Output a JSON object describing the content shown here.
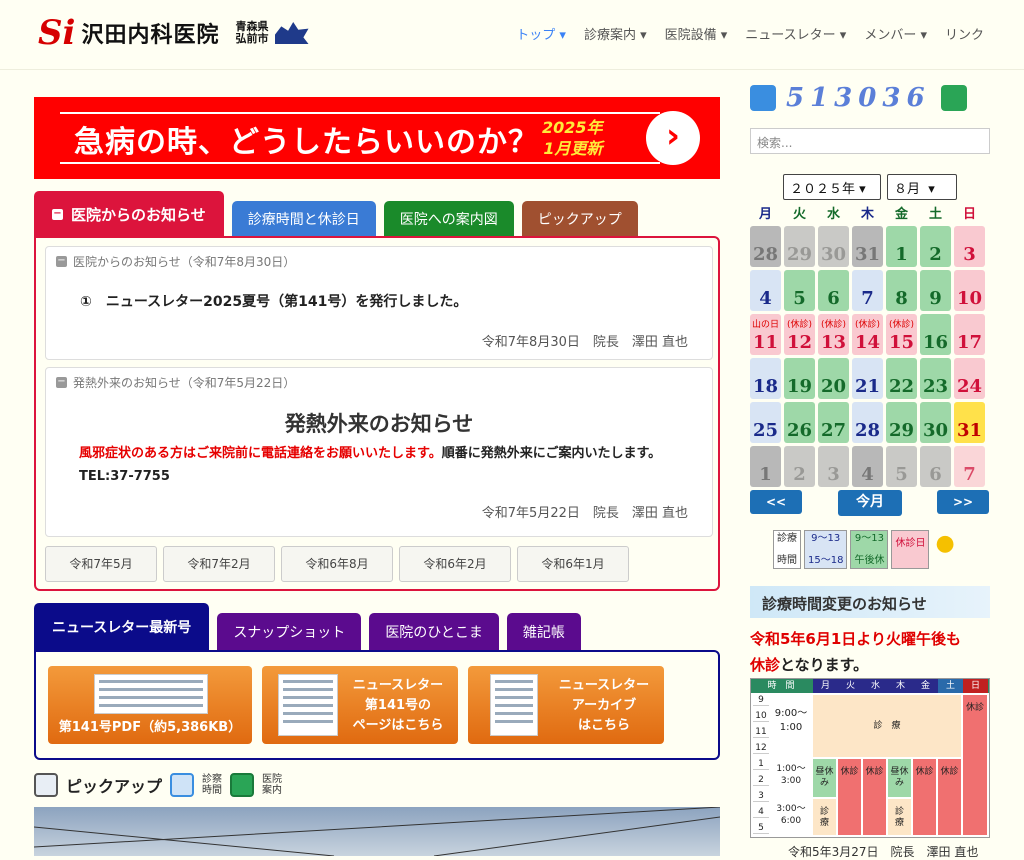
{
  "header": {
    "logo_mark": "Si",
    "logo_name": "沢田内科医院",
    "logo_pref": "青森県",
    "logo_city": "弘前市"
  },
  "nav": {
    "items": [
      {
        "label": "トップ ▾"
      },
      {
        "label": "診療案内 ▾"
      },
      {
        "label": "医院設備 ▾"
      },
      {
        "label": "ニュースレター ▾"
      },
      {
        "label": "メンバー ▾"
      },
      {
        "label": "リンク"
      }
    ]
  },
  "banner": {
    "text": "急病の時、どうしたらいいのか？",
    "sub1": "2025年",
    "sub2": "1月更新",
    "arrow": "›"
  },
  "tabs1": {
    "t0": "医院からのお知らせ",
    "t1": "診療時間と休診日",
    "t2": "医院への案内図",
    "t3": "ピックアップ"
  },
  "notice1": {
    "header": "医院からのお知らせ（令和7年8月30日）",
    "text": "①　ニュースレター2025夏号（第141号）を発行しました。",
    "sig": "令和7年8月30日　院長　澤田 直也"
  },
  "notice2": {
    "header": "発熱外来のお知らせ（令和7年5月22日）",
    "title": "発熱外来のお知らせ",
    "red": "風邪症状のある方はご来院前に電話連絡をお願いいたします。",
    "rest": "順番に発熱外来にご案内いたします。TEL:37-7755",
    "sig": "令和7年5月22日　院長　澤田 直也"
  },
  "archive": [
    "令和7年5月",
    "令和7年2月",
    "令和6年8月",
    "令和6年2月",
    "令和6年1月"
  ],
  "tabs2": {
    "t0": "ニュースレター最新号",
    "t1": "スナップショット",
    "t2": "医院のひとこま",
    "t3": "雑記帳"
  },
  "newsletter": {
    "b0": "第141号PDF（約5,386KB）",
    "b1a": "ニュースレター",
    "b1b": "第141号の",
    "b1c": "ページはこちら",
    "b2a": "ニュースレター",
    "b2b": "アーカイブ",
    "b2c": "はこちら"
  },
  "pickup": {
    "title": "ピックアップ",
    "l1a": "診察",
    "l1b": "時間",
    "l2a": "医院",
    "l2b": "案内"
  },
  "counter": {
    "value": "513036"
  },
  "search": {
    "placeholder": "検索..."
  },
  "calendar": {
    "year": "２０２５年",
    "month": "８月",
    "dow": [
      "月",
      "火",
      "水",
      "木",
      "金",
      "土",
      "日"
    ],
    "prev": "<<",
    "today": "今月",
    "next": ">>",
    "legend": {
      "a1": "診療",
      "a2": "時間",
      "b1": "9～13",
      "b2": "15～18",
      "c1": "9～13",
      "c2": "午後休",
      "d": "休診日"
    }
  },
  "hours_notice": {
    "title": "診療時間変更のお知らせ",
    "red": "令和5年6月1日より火曜午後も",
    "red2": "休診",
    "black": "となります。",
    "th_time": "時　間",
    "days": [
      "月",
      "火",
      "水",
      "木",
      "金",
      "土",
      "日"
    ],
    "rows": [
      "9",
      "10",
      "11",
      "12",
      "1",
      "2",
      "3",
      "4",
      "5"
    ],
    "am": "9:00～1:00",
    "shinryo": "診　療",
    "lunch": "1:00～3:00",
    "pm": "3:00～6:00",
    "hiru": "昼休み",
    "kyu": "休診",
    "foot": "令和5年3月27日　院長　澤田 直也"
  }
}
